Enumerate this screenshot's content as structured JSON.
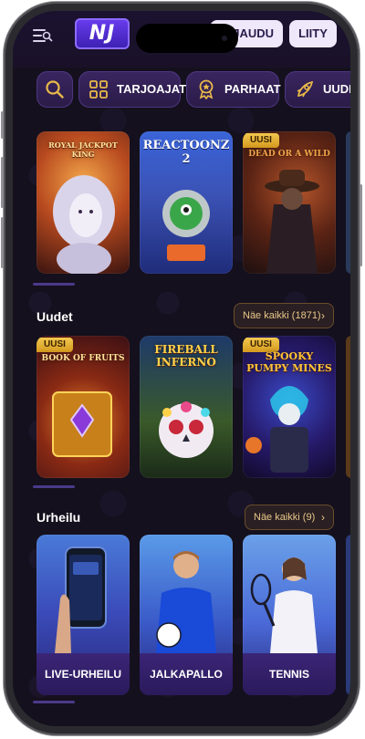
{
  "header": {
    "logo_text": "NJ",
    "login_label": "KIRJAUDU",
    "join_label": "LIITY"
  },
  "tabs": [
    {
      "label": "",
      "icon": "search-icon"
    },
    {
      "label": "TARJOAJAT",
      "icon": "grid-icon"
    },
    {
      "label": "PARHAAT",
      "icon": "award-icon"
    },
    {
      "label": "UUDET",
      "icon": "rocket-icon"
    }
  ],
  "top_row": {
    "tiles": [
      {
        "title": "ROYAL JACKPOT KING",
        "badge": ""
      },
      {
        "title": "REACTOONZ 2",
        "badge": ""
      },
      {
        "title": "DEAD OR A WILD",
        "badge": "UUSI"
      }
    ]
  },
  "new_section": {
    "title": "Uudet",
    "see_all": "Näe kaikki (1871)",
    "tiles": [
      {
        "title": "BOOK OF FRUITS",
        "badge": "UUSI"
      },
      {
        "title": "FIREBALL INFERNO",
        "badge": ""
      },
      {
        "title": "SPOOKY PUMPY MINES",
        "badge": "UUSI"
      }
    ]
  },
  "sports_section": {
    "title": "Urheilu",
    "see_all": "Näe kaikki (9)",
    "tiles": [
      {
        "label": "LIVE-URHEILU"
      },
      {
        "label": "JALKAPALLO"
      },
      {
        "label": "TENNIS"
      }
    ]
  },
  "colors": {
    "background": "#14101d",
    "accent_purple": "#6a3df0",
    "badge_gold": "#f2c84e",
    "tab_icon_gold": "#e9b94a"
  }
}
